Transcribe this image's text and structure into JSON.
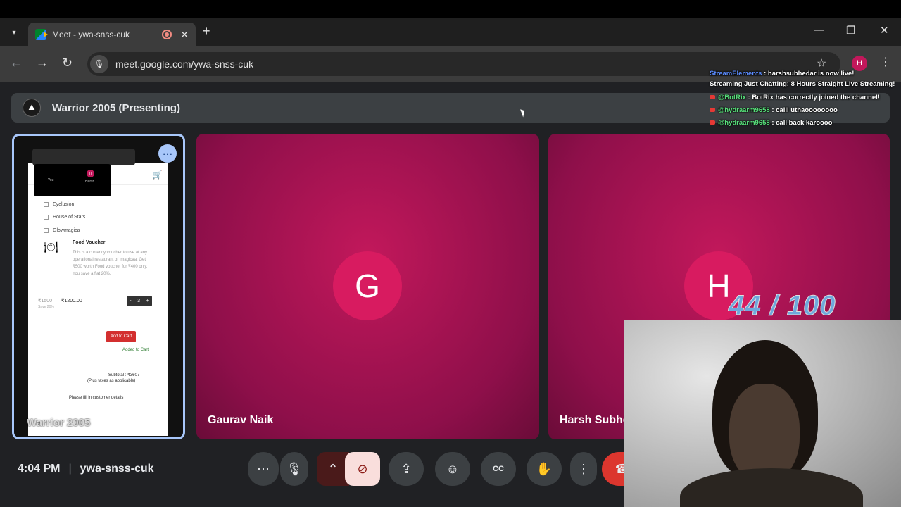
{
  "browser": {
    "tab_title": "Meet - ywa-snss-cuk",
    "url": "meet.google.com/ywa-snss-cuk",
    "profile_initial": "H"
  },
  "meeting": {
    "presenting_label": "Warrior 2005 (Presenting)",
    "time": "4:04 PM",
    "code": "ywa-snss-cuk"
  },
  "participants": [
    {
      "name": "Gaurav Naik",
      "initial": "G"
    },
    {
      "name": "Harsh Subhe",
      "initial": "H"
    }
  ],
  "presentation": {
    "owner_label": "Warrior 2005",
    "mini_you": "You",
    "mini_harsh": "Harsh",
    "items": [
      "Eyelusion",
      "House of Stars",
      "Glowmagica"
    ],
    "voucher_title": "Food Voucher",
    "voucher_desc": "This is a currency voucher to use at any operational restaurant of Imagicaa. Get ₹500 worth Food voucher for ₹400 only. You save a flat 20%.",
    "old_price": "₹1500",
    "new_price": "₹1200.00",
    "save_text": "Save 20%",
    "qty": "3",
    "add_to_cart": "Add to Cart",
    "added_to_cart": "Added to Cart",
    "subtotal": "Subtotal : ₹3607",
    "taxes": "(Plus taxes as applicable)",
    "fill_details": "Please fill in customer details"
  },
  "stream_overlay": {
    "chat": [
      {
        "user": "StreamElements",
        "message": ": harshsubhedar is now live!",
        "color": "blue"
      },
      {
        "user": "",
        "message": "Streaming Just Chatting: 8 Hours Straight Live Streaming!",
        "color": ""
      },
      {
        "user": "@BotRix",
        "message": ": BotRix has correctly joined the channel!",
        "color": "green"
      },
      {
        "user": "@hydraarm9658",
        "message": ": calll uthaoooooooo",
        "color": "green"
      },
      {
        "user": "@hydraarm9658",
        "message": ": call back karoooo",
        "color": "green"
      }
    ],
    "score": "44 / 100"
  },
  "icons": {
    "dropdown": "▾",
    "close": "✕",
    "new_tab": "+",
    "minimize": "—",
    "restore": "❐",
    "back": "←",
    "forward": "→",
    "reload": "↻",
    "mic": "🎙",
    "star": "☆",
    "kebab": "⋮",
    "more": "⋯",
    "chevron_up": "⌃",
    "cam_off": "⊘",
    "present": "⇪",
    "emoji": "☺",
    "captions": "CC",
    "hand": "✋",
    "end_call": "☎"
  },
  "colors": {
    "accent": "#a8c7fa",
    "tile": "#8e0f4a",
    "avatar": "#d81b60",
    "end_call": "#dc362e"
  }
}
